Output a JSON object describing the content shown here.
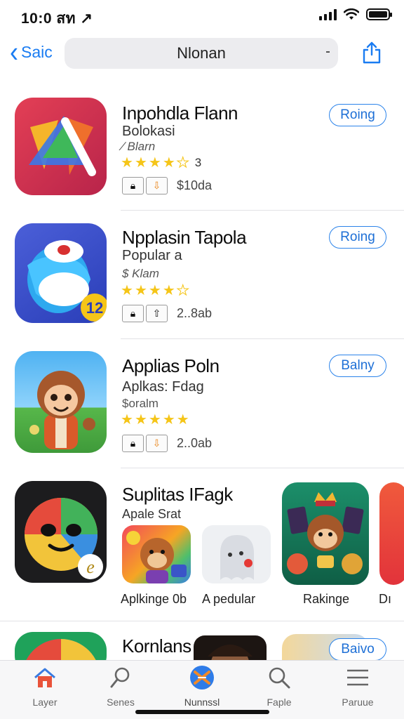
{
  "status": {
    "time": "10:0 สท ↗"
  },
  "nav": {
    "back_label": "Saic",
    "search_text": "Nlonan"
  },
  "apps": [
    {
      "name": "Inpohdla Flann",
      "subtitle": "Bolokasi",
      "meta": "∕ Blarn",
      "rating_count": "3",
      "badge_text": "$10da",
      "button": "Roing"
    },
    {
      "name": "Npplasin Tapola",
      "subtitle": "Popular a",
      "meta": "$ Klam",
      "rating_count": "",
      "badge_text": "2..8ab",
      "button": "Roing"
    },
    {
      "name": "Applias Poln",
      "subtitle": "Aplkas: Fdag",
      "meta": "$oralm",
      "rating_count": "",
      "badge_text": "2..0ab",
      "button": "Balny"
    },
    {
      "name": "Kornlans",
      "button": "Baivo"
    }
  ],
  "featured": {
    "title": "Suplitas IFagk",
    "subtitle": "Apale Srat",
    "tiles": [
      {
        "label": "Aplkinge 0b"
      },
      {
        "label": "A pedular"
      },
      {
        "label": "Rakinge"
      },
      {
        "label": "Dı"
      }
    ]
  },
  "tabs": [
    {
      "label": "Layer",
      "icon": "home-icon"
    },
    {
      "label": "Senes",
      "icon": "search-loupe-icon"
    },
    {
      "label": "Nunnssl",
      "icon": "apps-icon"
    },
    {
      "label": "Faple",
      "icon": "search-icon"
    },
    {
      "label": "Paruue",
      "icon": "menu-icon"
    }
  ],
  "colors": {
    "accent": "#1a7cf2",
    "star": "#f5c518"
  }
}
